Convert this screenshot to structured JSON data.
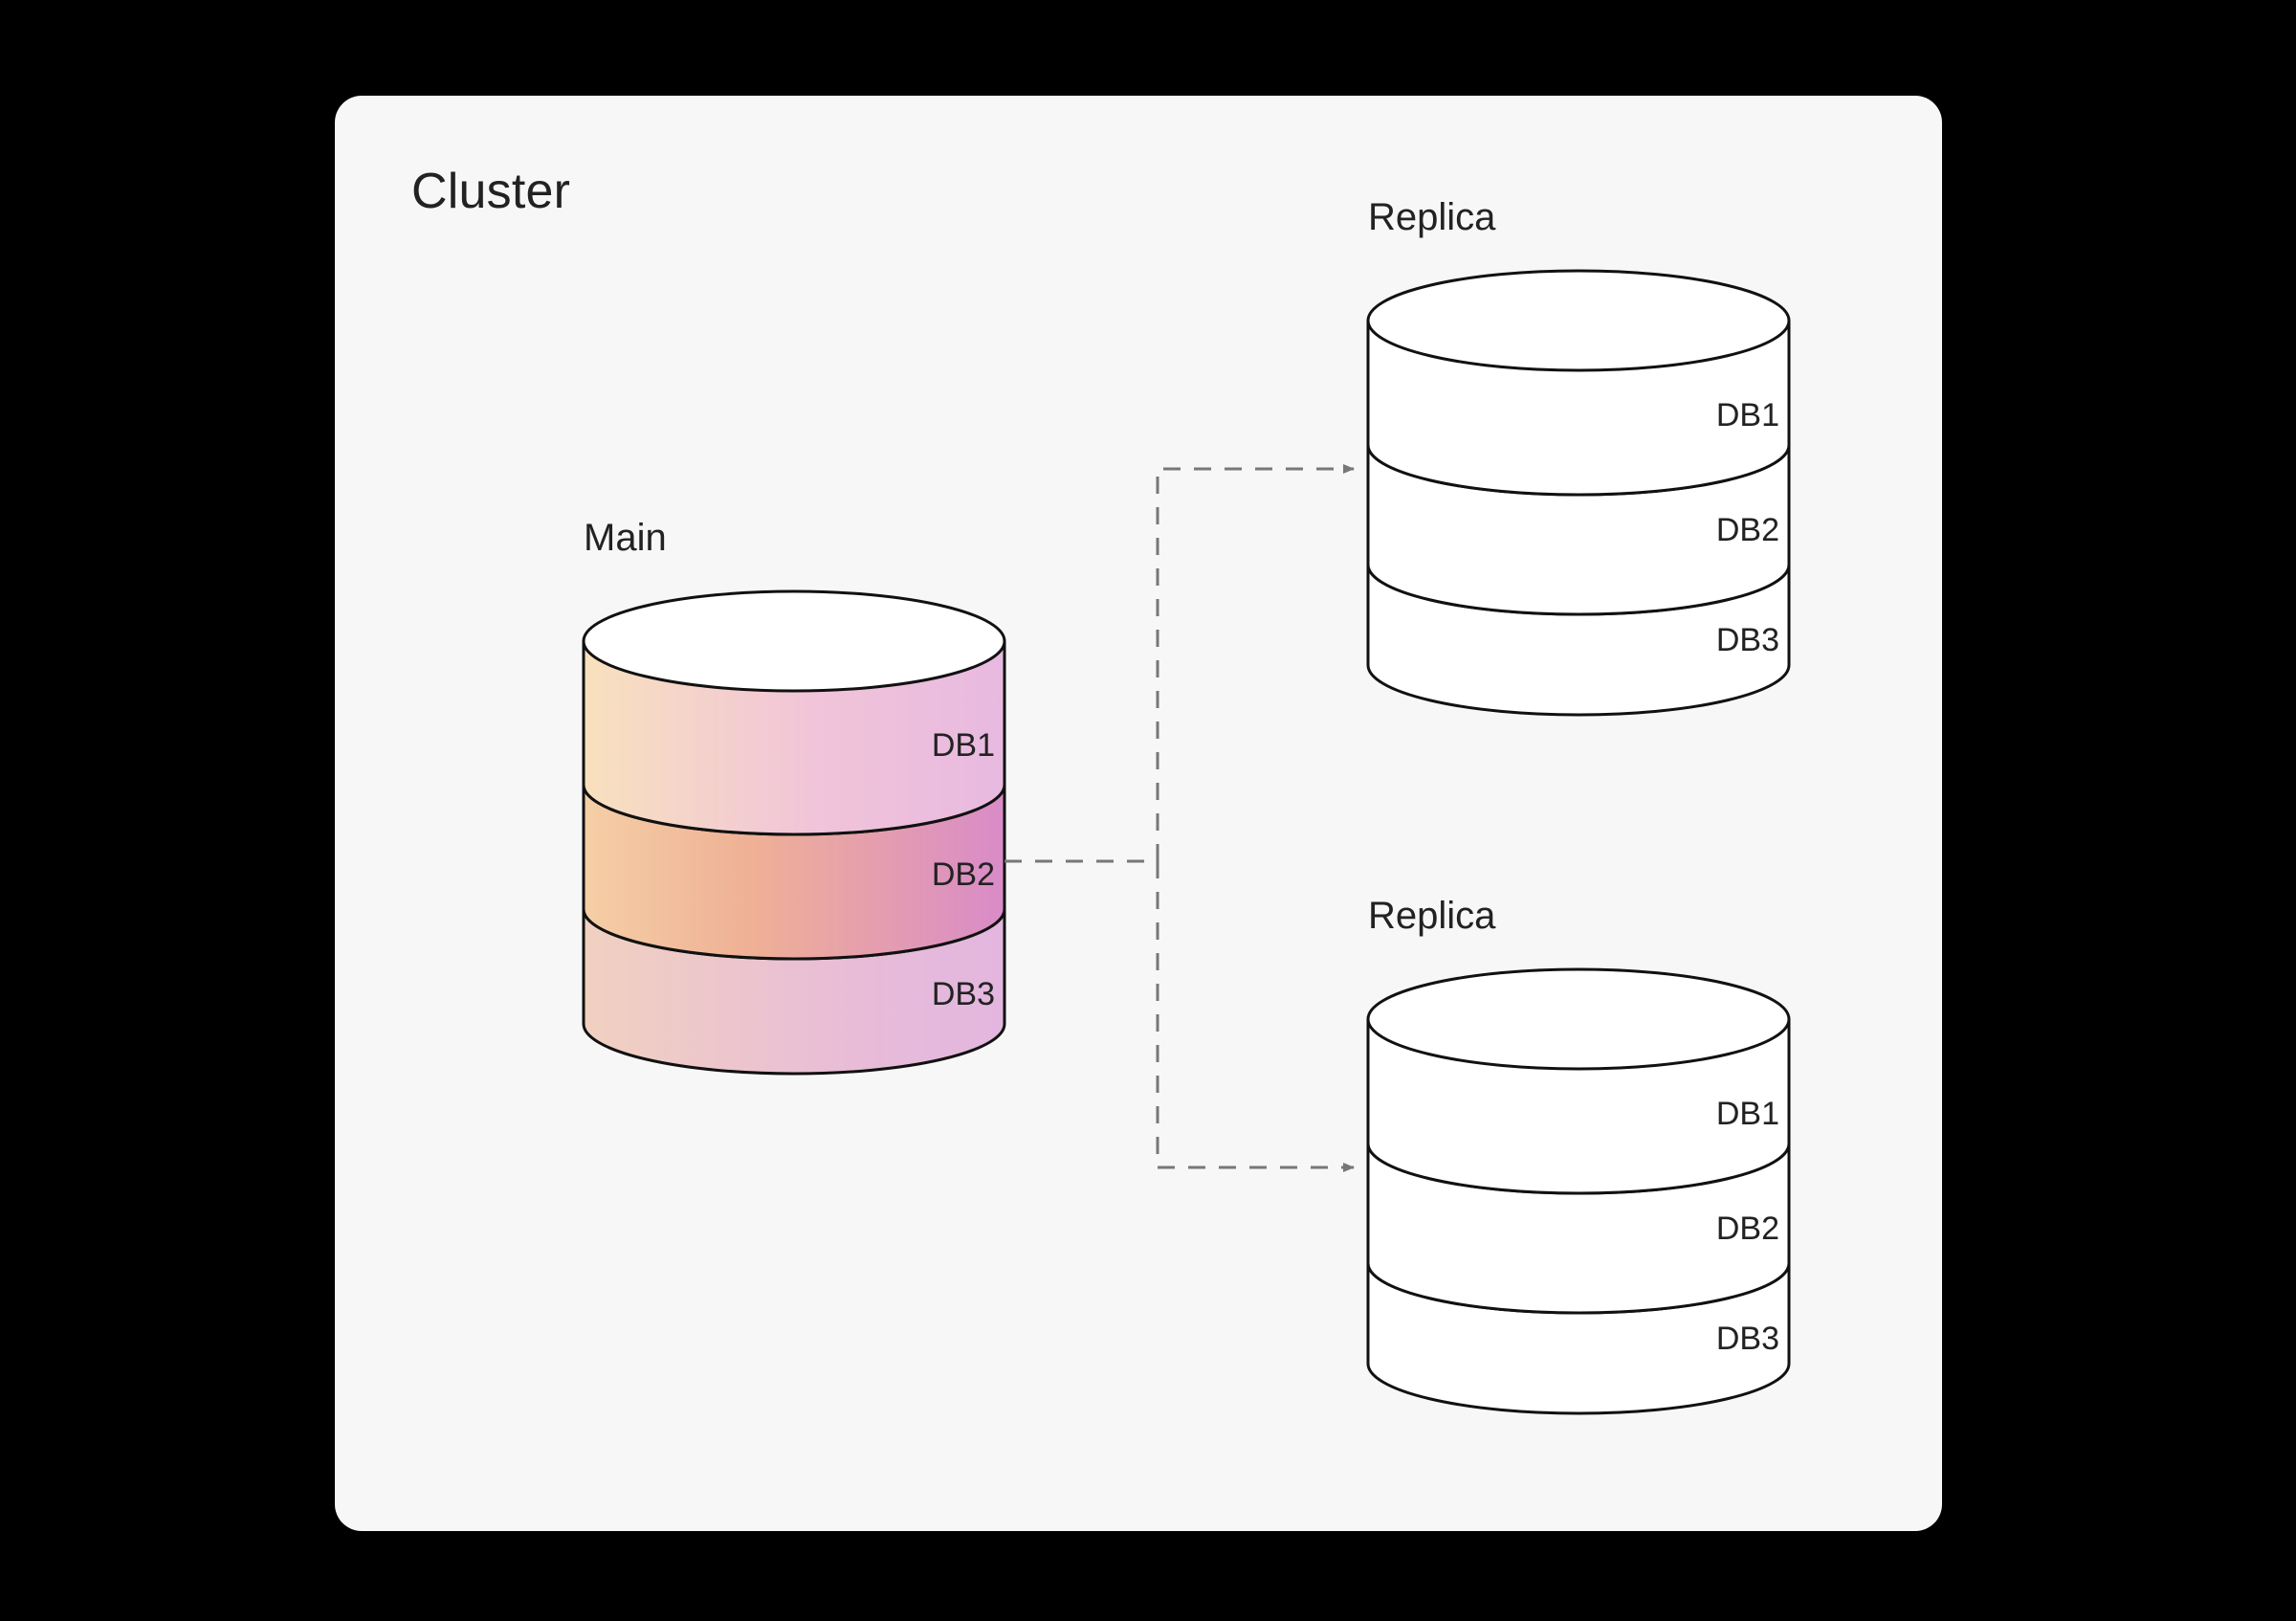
{
  "cluster": {
    "title": "Cluster",
    "main": {
      "title": "Main",
      "databases": [
        "DB1",
        "DB2",
        "DB3"
      ]
    },
    "replicas": [
      {
        "title": "Replica",
        "databases": [
          "DB1",
          "DB2",
          "DB3"
        ]
      },
      {
        "title": "Replica",
        "databases": [
          "DB1",
          "DB2",
          "DB3"
        ]
      }
    ]
  }
}
